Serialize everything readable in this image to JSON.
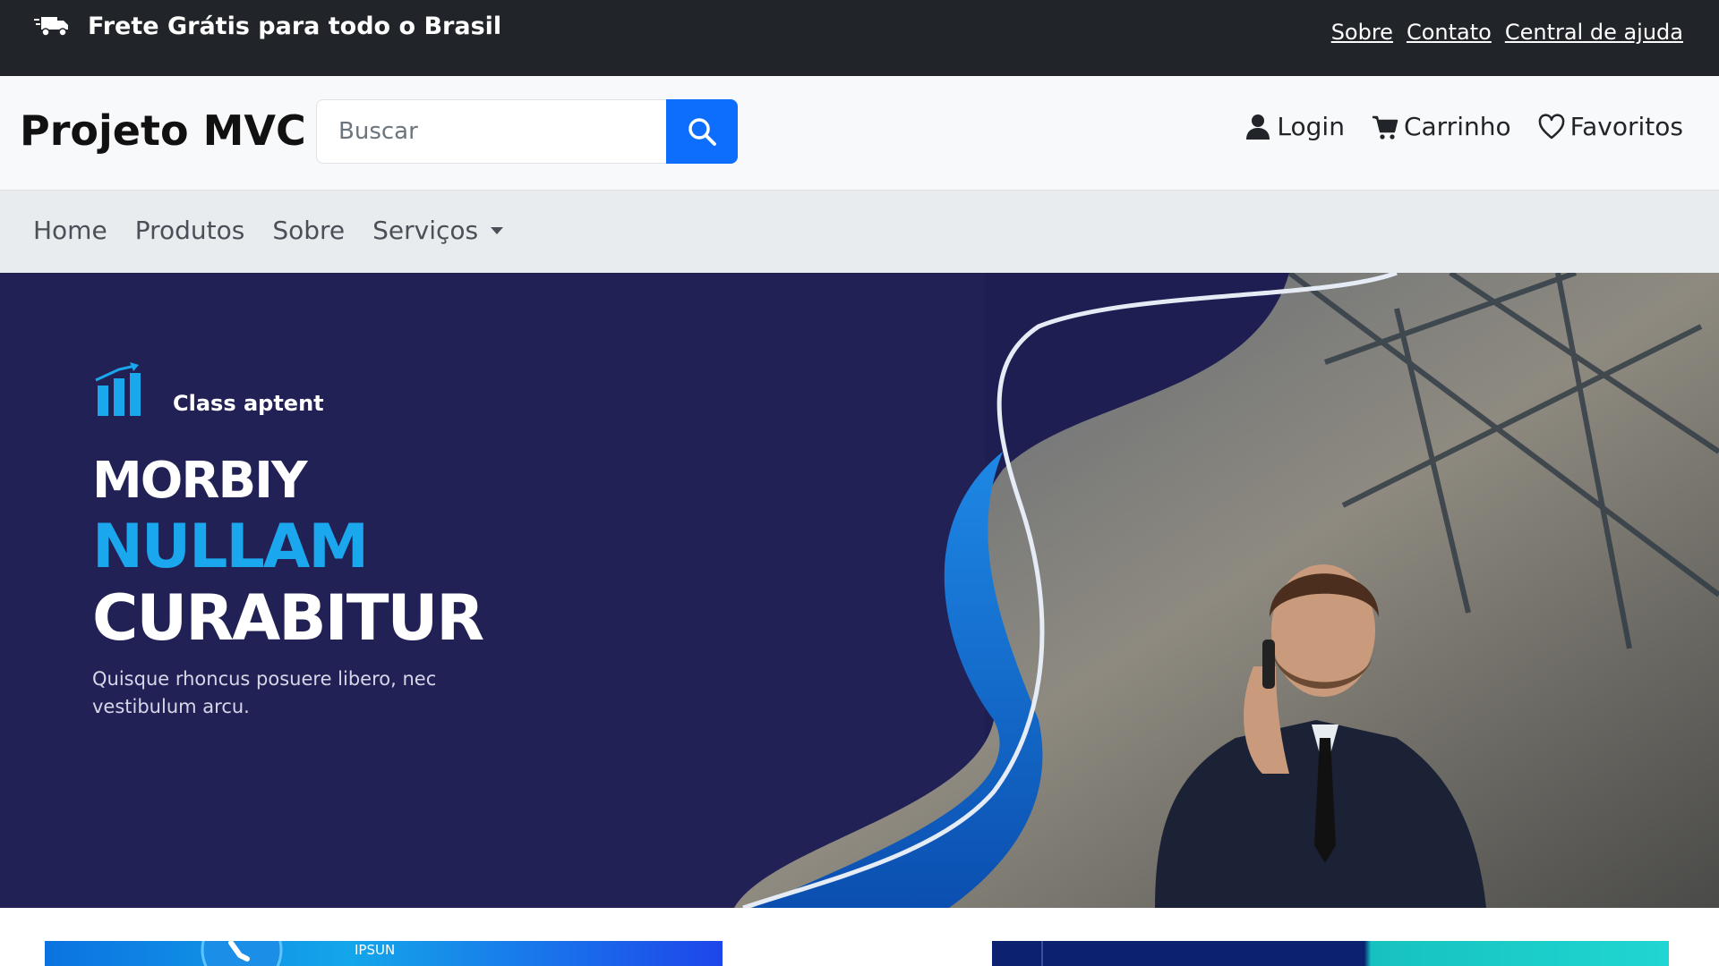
{
  "topbar": {
    "promo_text": "Frete Grátis para todo o Brasil",
    "links": [
      "Sobre",
      "Contato",
      "Central de ajuda"
    ]
  },
  "header": {
    "brand": "Projeto MVC",
    "search_placeholder": "Buscar",
    "actions": [
      "Login",
      "Carrinho",
      "Favoritos"
    ]
  },
  "nav": {
    "items": [
      "Home",
      "Produtos",
      "Sobre",
      "Serviços"
    ]
  },
  "hero": {
    "kicker": "Class aptent",
    "line1": "MORBIY",
    "line2": "NULLAM",
    "line3": "CURABITUR",
    "description": "Quisque rhoncus posuere libero, nec vestibulum arcu."
  },
  "cards": {
    "card1_text": "IPSUN"
  },
  "colors": {
    "topbar_bg": "#212529",
    "accent": "#0d6efd",
    "hero_bg": "#1c1b4e",
    "hero_highlight": "#1aa7ee"
  },
  "icons": [
    "truck-icon",
    "search-icon",
    "user-icon",
    "cart-icon",
    "heart-icon",
    "chevron-down-icon",
    "chart-logo-icon"
  ]
}
